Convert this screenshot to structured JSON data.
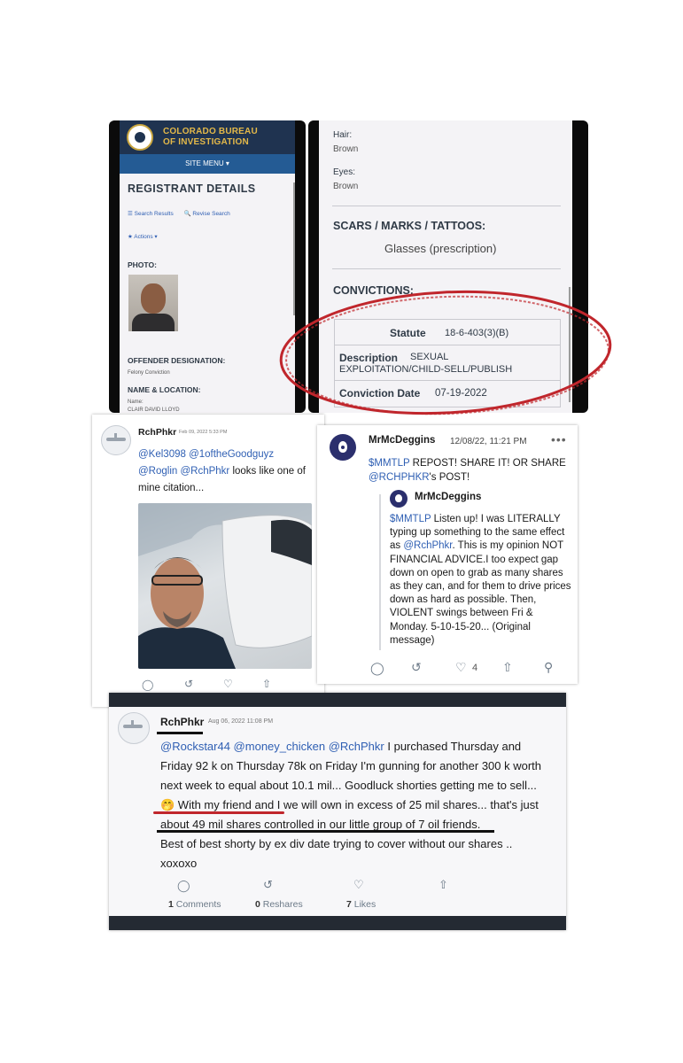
{
  "cbi": {
    "org_line1": "COLORADO BUREAU",
    "org_line2": "OF INVESTIGATION",
    "site_menu": "SITE MENU ▾",
    "title": "REGISTRANT DETAILS",
    "search_results": "☰ Search Results",
    "revise_search": "🔍 Revise Search",
    "actions": "★ Actions ▾",
    "photo_label": "PHOTO:",
    "designation_label": "OFFENDER DESIGNATION:",
    "designation_value": "Felony Conviction",
    "name_location_label": "NAME & LOCATION:",
    "name_label": "Name:",
    "name_value": "CLAIR DAVID LLOYD"
  },
  "details": {
    "hair_label": "Hair:",
    "hair_value": "Brown",
    "eyes_label": "Eyes:",
    "eyes_value": "Brown",
    "scars_label": "SCARS / MARKS / TATTOOS:",
    "scars_value": "Glasses (prescription)",
    "convictions_label": "CONVICTIONS:",
    "statute_label": "Statute",
    "statute_value": "18-6-403(3)(B)",
    "description_label": "Description",
    "description_value_1": "SEXUAL",
    "description_value_2": "EXPLOITATION/CHILD-SELL/PUBLISH",
    "conviction_date_label": "Conviction Date",
    "conviction_date_value": "07-19-2022",
    "circle_color": "#c0262c"
  },
  "tweet1": {
    "name": "RchPhkr",
    "date": "Feb 09, 2022 5:33 PM",
    "mentions": "@Kel3098 @1oftheGoodguyz @Roglin @RchPhkr",
    "text": " looks like one of mine citation...",
    "actions": [
      "comment-icon",
      "reshare-icon",
      "like-icon",
      "share-icon"
    ]
  },
  "tweet2": {
    "name": "MrMcDeggins",
    "date": "12/08/22, 11:21 PM",
    "more": "•••",
    "text_cashtag": "$MMTLP",
    "text_1": " REPOST! SHARE IT! OR SHARE ",
    "text_mention": "@RCHPHKR",
    "text_2": "'s POST!",
    "quote_name": "MrMcDeggins",
    "quote_cashtag": "$MMTLP",
    "quote_text_1": " Listen up! I was LITERALLY typing up something to the same effect as ",
    "quote_mention": "@RchPhkr",
    "quote_text_2": ". This is my opinion NOT FINANCIAL ADVICE.I too expect gap down on open to grab as many shares as they can, and for them to drive prices down as hard as possible. Then, VIOLENT swings between Fri & Monday. 5-10-15-20... (Original message)",
    "like_count": "4"
  },
  "tweet3": {
    "name": "RchPhkr",
    "date": "Aug 06, 2022 11:08 PM",
    "mentions": "@Rockstar44 @money_chicken @RchPhkr",
    "line1_rest": " I purchased Thursday and",
    "line2": "Friday 92 k on Thursday  78k on Friday I'm gunning for another 300 k worth",
    "line3": "next week to equal about 10.1 mil... Goodluck shorties getting me to sell...",
    "line4": "🤭 With my friend and I we will own in excess of 25 mil shares... that's just",
    "line5": "about 49 mil shares controlled in our little group of 7 oil friends.",
    "line6": "Best of best shorty by ex div date trying to cover without our shares ..",
    "line7": "xoxoxo",
    "comments_count": "1",
    "comments_label": " Comments",
    "reshares_count": "0",
    "reshares_label": " Reshares",
    "likes_count": "7",
    "likes_label": " Likes",
    "highlight_red": "#c0262c"
  }
}
